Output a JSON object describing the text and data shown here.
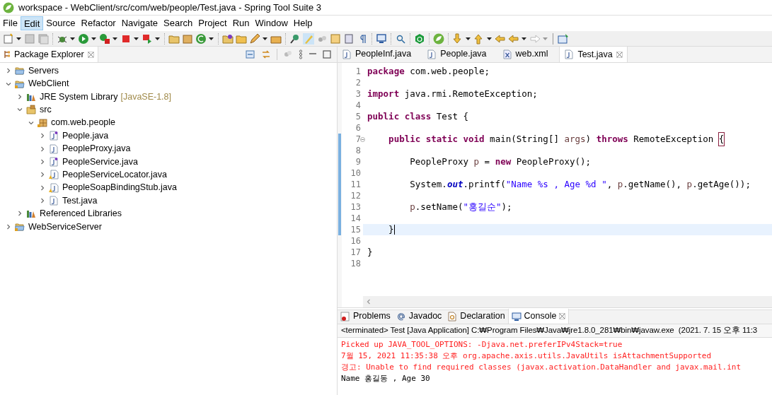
{
  "window": {
    "title": "workspace - WebClient/src/com/web/people/Test.java - Spring Tool Suite 3"
  },
  "menu": [
    {
      "label": "File",
      "highlighted": false
    },
    {
      "label": "Edit",
      "highlighted": true
    },
    {
      "label": "Source",
      "highlighted": false
    },
    {
      "label": "Refactor",
      "highlighted": false
    },
    {
      "label": "Navigate",
      "highlighted": false
    },
    {
      "label": "Search",
      "highlighted": false
    },
    {
      "label": "Project",
      "highlighted": false
    },
    {
      "label": "Run",
      "highlighted": false
    },
    {
      "label": "Window",
      "highlighted": false
    },
    {
      "label": "Help",
      "highlighted": false
    }
  ],
  "package_explorer": {
    "title": "Package Explorer",
    "tree": [
      {
        "label": "Servers",
        "kind": "folder",
        "expanded": false
      },
      {
        "label": "WebClient",
        "kind": "project",
        "expanded": true,
        "children": [
          {
            "label": "JRE System Library",
            "decoration": "[JavaSE-1.8]",
            "kind": "library",
            "expanded": false
          },
          {
            "label": "src",
            "kind": "source",
            "expanded": true,
            "children": [
              {
                "label": "com.web.people",
                "kind": "package",
                "expanded": true,
                "children": [
                  {
                    "label": "People.java",
                    "kind": "interface",
                    "expanded": false
                  },
                  {
                    "label": "PeopleProxy.java",
                    "kind": "java",
                    "expanded": false
                  },
                  {
                    "label": "PeopleService.java",
                    "kind": "interface",
                    "expanded": false
                  },
                  {
                    "label": "PeopleServiceLocator.java",
                    "kind": "java-warning",
                    "expanded": false
                  },
                  {
                    "label": "PeopleSoapBindingStub.java",
                    "kind": "java-warning",
                    "expanded": false
                  },
                  {
                    "label": "Test.java",
                    "kind": "java",
                    "expanded": false
                  }
                ]
              }
            ]
          },
          {
            "label": "Referenced Libraries",
            "kind": "library",
            "expanded": false
          }
        ]
      },
      {
        "label": "WebServiceServer",
        "kind": "project",
        "expanded": false
      }
    ]
  },
  "editor": {
    "tabs": [
      {
        "label": "PeopleInf.java",
        "kind": "java",
        "selected": false
      },
      {
        "label": "People.java",
        "kind": "java",
        "selected": false
      },
      {
        "label": "web.xml",
        "kind": "xml",
        "selected": false
      },
      {
        "label": "Test.java",
        "kind": "java",
        "selected": true
      }
    ],
    "lines": [
      {
        "no": "1",
        "marked": false,
        "current": false,
        "foldable": false,
        "tokens": [
          {
            "kind": "kw",
            "text": "package"
          },
          {
            "kind": "text",
            "text": " com.web.people;"
          }
        ]
      },
      {
        "no": "2",
        "marked": false,
        "current": false,
        "foldable": false
      },
      {
        "no": "3",
        "marked": false,
        "current": false,
        "foldable": false,
        "tokens": [
          {
            "kind": "kw",
            "text": "import"
          },
          {
            "kind": "text",
            "text": " java.rmi.RemoteException;"
          }
        ]
      },
      {
        "no": "4",
        "marked": false,
        "current": false,
        "foldable": false
      },
      {
        "no": "5",
        "marked": false,
        "current": false,
        "foldable": false,
        "tokens": [
          {
            "kind": "kw",
            "text": "public class"
          },
          {
            "kind": "text",
            "text": " Test {"
          }
        ]
      },
      {
        "no": "6",
        "marked": false,
        "current": false,
        "foldable": false
      },
      {
        "no": "7",
        "marked": true,
        "current": false,
        "foldable": true,
        "tokens": [
          {
            "kind": "kw",
            "text": "    public static void"
          },
          {
            "kind": "text",
            "text": " main(String[] "
          },
          {
            "kind": "local",
            "text": "args"
          },
          {
            "kind": "text",
            "text": ") "
          },
          {
            "kind": "kw",
            "text": "throws"
          },
          {
            "kind": "text",
            "text": " RemoteException "
          },
          {
            "kind": "bracket",
            "text": "{"
          }
        ]
      },
      {
        "no": "8",
        "marked": true,
        "current": false,
        "foldable": false
      },
      {
        "no": "9",
        "marked": true,
        "current": false,
        "foldable": false,
        "tokens": [
          {
            "kind": "text",
            "text": "        PeopleProxy "
          },
          {
            "kind": "local",
            "text": "p"
          },
          {
            "kind": "text",
            "text": " = "
          },
          {
            "kind": "kw",
            "text": "new"
          },
          {
            "kind": "text",
            "text": " PeopleProxy();"
          }
        ]
      },
      {
        "no": "10",
        "marked": true,
        "current": false,
        "foldable": false
      },
      {
        "no": "11",
        "marked": true,
        "current": false,
        "foldable": false,
        "tokens": [
          {
            "kind": "text",
            "text": "        System."
          },
          {
            "kind": "field",
            "text": "out"
          },
          {
            "kind": "text",
            "text": ".printf("
          },
          {
            "kind": "str",
            "text": "\"Name %s , Age %d \""
          },
          {
            "kind": "text",
            "text": ", "
          },
          {
            "kind": "local",
            "text": "p"
          },
          {
            "kind": "text",
            "text": ".getName(), "
          },
          {
            "kind": "local",
            "text": "p"
          },
          {
            "kind": "text",
            "text": ".getAge());"
          }
        ]
      },
      {
        "no": "12",
        "marked": true,
        "current": false,
        "foldable": false
      },
      {
        "no": "13",
        "marked": true,
        "current": false,
        "foldable": false,
        "tokens": [
          {
            "kind": "local",
            "text": "        p"
          },
          {
            "kind": "text",
            "text": ".setName("
          },
          {
            "kind": "str",
            "text": "\"홍길순\""
          },
          {
            "kind": "text",
            "text": ");"
          }
        ]
      },
      {
        "no": "14",
        "marked": true,
        "current": false,
        "foldable": false
      },
      {
        "no": "15",
        "marked": true,
        "current": true,
        "foldable": false,
        "tokens": [
          {
            "kind": "text",
            "text": "    }"
          }
        ]
      },
      {
        "no": "16",
        "marked": false,
        "current": false,
        "foldable": false
      },
      {
        "no": "17",
        "marked": false,
        "current": false,
        "foldable": false,
        "tokens": [
          {
            "kind": "text",
            "text": "}"
          }
        ]
      },
      {
        "no": "18",
        "marked": false,
        "current": false,
        "foldable": false
      }
    ]
  },
  "bottom_panel": {
    "tabs": [
      {
        "label": "Problems",
        "kind": "problems",
        "selected": false
      },
      {
        "label": "Javadoc",
        "kind": "javadoc",
        "selected": false
      },
      {
        "label": "Declaration",
        "kind": "declaration",
        "selected": false
      },
      {
        "label": "Console",
        "kind": "console",
        "selected": true
      }
    ],
    "console_header": "<terminated> Test [Java Application] C:₩Program Files₩Java₩jre1.8.0_281₩bin₩javaw.exe  (2021. 7. 15 오후 11:3",
    "output": [
      {
        "kind": "err",
        "text": "Picked up JAVA_TOOL_OPTIONS: -Djava.net.preferIPv4Stack=true"
      },
      {
        "kind": "err",
        "text": "7월 15, 2021 11:35:38 오후 org.apache.axis.utils.JavaUtils isAttachmentSupported"
      },
      {
        "kind": "err",
        "text": "경고: Unable to find required classes (javax.activation.DataHandler and javax.mail.int"
      },
      {
        "kind": "out",
        "text": "Name 홍길동 , Age 30"
      }
    ]
  }
}
